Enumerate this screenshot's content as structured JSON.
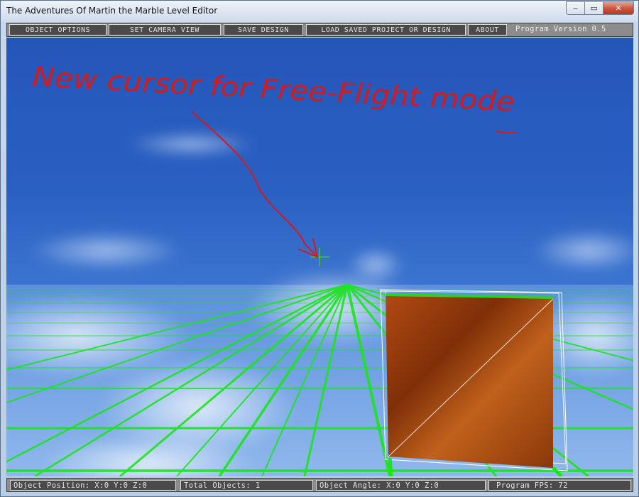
{
  "window": {
    "title": "The Adventures Of Martin the Marble Level Editor",
    "controls": {
      "minimize": "‒",
      "maximize": "▭",
      "close": "✕"
    }
  },
  "menu": {
    "object_options": "OBJECT OPTIONS",
    "set_camera_view": "SET CAMERA VIEW",
    "save_design": "SAVE DESIGN",
    "load_saved": "LOAD SAVED PROJECT OR DESIGN",
    "about": "ABOUT",
    "version": "Program Version 0.5"
  },
  "annotation": {
    "text": "New cursor for Free-Flight mode"
  },
  "status": {
    "object_position": "Object Position: X:0 Y:0 Z:0",
    "total_objects": "Total Objects: 1",
    "object_angle": "Object Angle: X:0 Y:0 Z:0",
    "fps": "Program FPS: 72"
  },
  "colors": {
    "sky_top": "#2456b8",
    "grid_line": "#19e619",
    "annotation_ink": "#d61a1a",
    "crosshair": "#2bd12b",
    "cube_face": "#a8440e"
  }
}
